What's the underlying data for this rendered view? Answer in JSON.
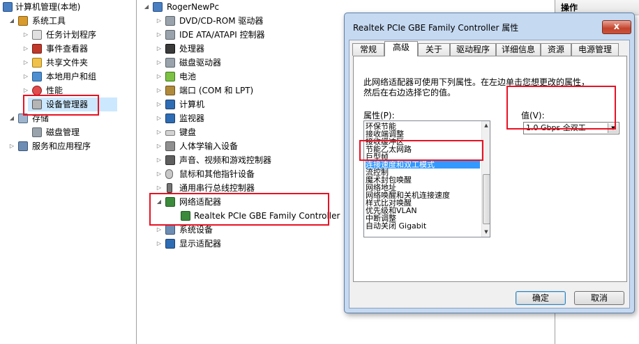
{
  "left_tree": {
    "root": "计算机管理(本地)",
    "items": [
      {
        "label": "系统工具",
        "icon": "tools-icon"
      },
      {
        "label": "任务计划程序",
        "icon": "task-scheduler-icon"
      },
      {
        "label": "事件查看器",
        "icon": "event-viewer-icon"
      },
      {
        "label": "共享文件夹",
        "icon": "shared-folder-icon"
      },
      {
        "label": "本地用户和组",
        "icon": "users-icon"
      },
      {
        "label": "性能",
        "icon": "performance-icon"
      },
      {
        "label": "设备管理器",
        "icon": "device-manager-icon"
      },
      {
        "label": "存储",
        "icon": "storage-icon"
      },
      {
        "label": "磁盘管理",
        "icon": "disk-management-icon"
      },
      {
        "label": "服务和应用程序",
        "icon": "services-icon"
      }
    ]
  },
  "device_tree": {
    "root": "RogerNewPc",
    "categories": [
      "DVD/CD-ROM 驱动器",
      "IDE ATA/ATAPI 控制器",
      "处理器",
      "磁盘驱动器",
      "电池",
      "端口 (COM 和 LPT)",
      "计算机",
      "监视器",
      "键盘",
      "人体学输入设备",
      "声音、视频和游戏控制器",
      "鼠标和其他指针设备",
      "通用串行总线控制器",
      "网络适配器",
      "Realtek PCIe GBE Family Controller",
      "系统设备",
      "显示适配器"
    ]
  },
  "actions": {
    "header": "操作"
  },
  "dialog": {
    "title": "Realtek PCIe GBE Family Controller 属性",
    "close": "x",
    "tabs": [
      "常规",
      "高级",
      "关于",
      "驱动程序",
      "详细信息",
      "资源",
      "电源管理"
    ],
    "active_tab": "高级",
    "description": "此网络适配器可使用下列属性。在左边单击您想更改的属性，然后在右边选择它的值。",
    "property_label": "属性(P):",
    "value_label": "值(V):",
    "properties": [
      "环保节能",
      "接收端调整",
      "接收缓冲区",
      "节能乙太网路",
      "巨型帧",
      "连接速度和双工模式",
      "流控制",
      "魔术封包唤醒",
      "网络地址",
      "网络唤醒和关机连接速度",
      "样式比对唤醒",
      "优先级和VLAN",
      "中断调整",
      "自动关闭 Gigabit"
    ],
    "selected_property": "连接速度和双工模式",
    "value": "1.0 Gbps 全双工",
    "ok": "确定",
    "cancel": "取消"
  },
  "highlight_color": "#e81123"
}
